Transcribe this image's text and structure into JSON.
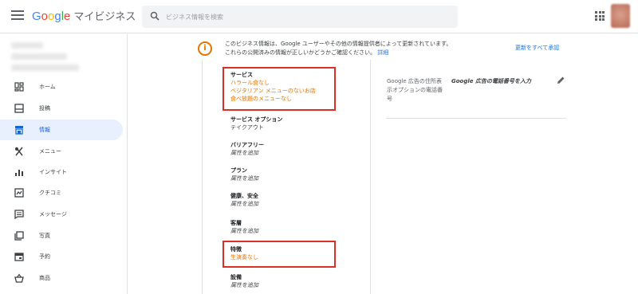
{
  "header": {
    "logo_letters": [
      "G",
      "o",
      "o",
      "g",
      "l",
      "e"
    ],
    "product": "マイビジネス",
    "search_placeholder": "ビジネス情報を検索"
  },
  "sidebar": {
    "items": [
      {
        "label": "ホーム",
        "icon": "home-dashboard-icon"
      },
      {
        "label": "投稿",
        "icon": "post-icon"
      },
      {
        "label": "情報",
        "icon": "info-store-icon",
        "active": true
      },
      {
        "label": "メニュー",
        "icon": "menu-utensils-icon"
      },
      {
        "label": "インサイト",
        "icon": "insights-icon"
      },
      {
        "label": "クチコミ",
        "icon": "reviews-icon"
      },
      {
        "label": "メッセージ",
        "icon": "message-icon"
      },
      {
        "label": "写真",
        "icon": "photos-icon"
      },
      {
        "label": "予約",
        "icon": "calendar-icon"
      },
      {
        "label": "商品",
        "icon": "shopping-basket-icon"
      }
    ]
  },
  "banner": {
    "line1": "このビジネス情報は、Google ユーザーやその他の情報提供者によって更新されています。",
    "line2": "これらの公開済みの情報が正しいかどうかご確認ください。",
    "link": "詳細",
    "accept_all": "更新をすべて承認"
  },
  "attributes": {
    "service": {
      "title": "サービス",
      "values": [
        "ハラール食なし",
        "ベジタリアン メニューのないお店",
        "食べ放題のメニューなし"
      ]
    },
    "service_options": {
      "title": "サービス オプション",
      "value": "テイクアウト"
    },
    "barrier_free": {
      "title": "バリアフリー",
      "value": "属性を追加"
    },
    "plans": {
      "title": "プラン",
      "value": "属性を追加"
    },
    "health_safety": {
      "title": "健康、安全",
      "value": "属性を追加"
    },
    "customers": {
      "title": "客層",
      "value": "属性を追加"
    },
    "features": {
      "title": "特徴",
      "value": "生演奏なし"
    },
    "facilities": {
      "title": "設備",
      "value": "属性を追加"
    }
  },
  "ads": {
    "label": "Google 広告の住所表示オプションの電話番号",
    "value": "Google 広告の電話番号を入力"
  },
  "colors": {
    "accent_blue": "#1a73e8",
    "update_orange": "#e37400",
    "highlight_red": "#d93025"
  }
}
